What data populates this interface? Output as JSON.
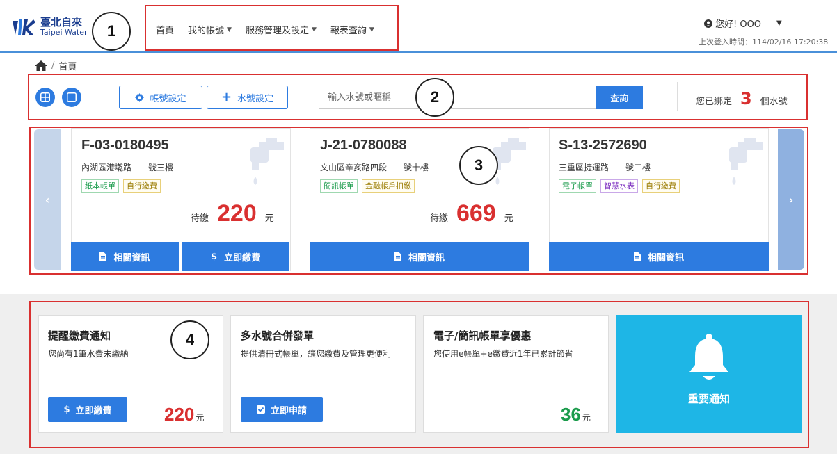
{
  "header": {
    "logo_zh": "臺北自來",
    "logo_en": "Taipei Water",
    "nav": [
      {
        "label": "首頁"
      },
      {
        "label": "我的帳號"
      },
      {
        "label": "服務管理及設定"
      },
      {
        "label": "報表查詢"
      }
    ],
    "user_greeting": "您好! OOO",
    "last_login": "上次登入時間：114/02/16 17:20:38"
  },
  "breadcrumb": {
    "current": "首頁"
  },
  "toolbar": {
    "account_settings": "帳號設定",
    "water_settings": "水號設定",
    "search_placeholder": "輸入水號或暱稱",
    "search_button": "查詢",
    "bound_prefix": "您已綁定",
    "bound_count": "3",
    "bound_suffix": "個水號"
  },
  "cards": [
    {
      "number": "F-03-0180495",
      "address": "內湖區港墘路　　號三樓",
      "tags": [
        "紙本帳單",
        "自行繳費"
      ],
      "due_label": "待繳",
      "due_amount": "220",
      "due_unit": "元",
      "info_button": "相關資訊",
      "pay_button": "立即繳費"
    },
    {
      "number": "J-21-0780088",
      "address": "文山區辛亥路四段　　號十樓",
      "tags": [
        "簡訊帳單",
        "金融帳戶扣繳"
      ],
      "due_label": "待繳",
      "due_amount": "669",
      "due_unit": "元",
      "info_button": "相關資訊"
    },
    {
      "number": "S-13-2572690",
      "address": "三重區捷運路　　號二樓",
      "tags": [
        "電子帳單",
        "智慧水表",
        "自行繳費"
      ],
      "info_button": "相關資訊"
    }
  ],
  "promos": {
    "reminder": {
      "title": "提醒繳費通知",
      "desc": "您尚有1筆水費未繳納",
      "button": "立即繳費",
      "amount": "220",
      "unit": "元"
    },
    "merge": {
      "title": "多水號合併發單",
      "desc": "提供清冊式帳單，讓您繳費及管理更便利",
      "button": "立即申請"
    },
    "ebill": {
      "title": "電子/簡訊帳單享優惠",
      "desc": "您使用e帳單+e繳費近1年已累計節省",
      "amount": "36",
      "unit": "元"
    },
    "notice": {
      "label": "重要通知"
    }
  },
  "annotations": [
    "1",
    "2",
    "3",
    "4"
  ],
  "colors": {
    "primary": "#2d7be0",
    "accent_red": "#d93030",
    "green": "#1a9b4b",
    "notice_bg": "#1eb6e6",
    "annotation": "#d93030"
  }
}
